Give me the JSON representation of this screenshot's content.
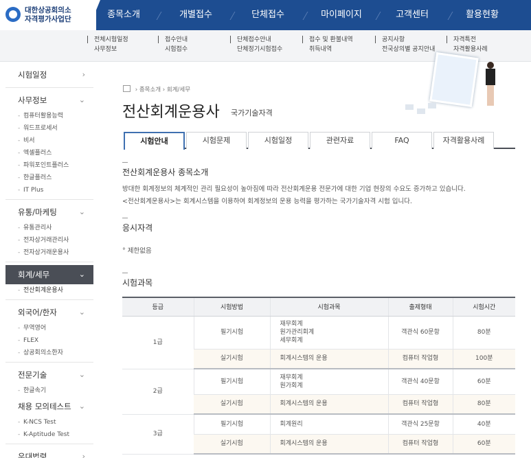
{
  "logo": {
    "line1": "대한상공회의소",
    "line2": "자격평가사업단"
  },
  "nav": [
    "종목소개",
    "개별접수",
    "단체접수",
    "마이페이지",
    "고객센터",
    "활용현황"
  ],
  "submenu": [
    [
      "전체시험일정",
      "사무정보"
    ],
    [
      "접수안내",
      "시험접수"
    ],
    [
      "단체접수안내",
      "단체정기시험접수"
    ],
    [
      "접수 및 환불내역",
      "취득내역"
    ],
    [
      "공지사항",
      "전국상의별 공지안내"
    ],
    [
      "자격특전",
      "자격활용사례"
    ]
  ],
  "sidebar": {
    "sched": "시험일정",
    "office": {
      "label": "사무정보",
      "items": [
        "컴퓨터활용능력",
        "워드프로세서",
        "비서",
        "엑셀플러스",
        "파워포인트플러스",
        "한글플러스",
        "IT Plus"
      ]
    },
    "marketing": {
      "label": "유통/마케팅",
      "items": [
        "유통관리사",
        "전자상거래관리사",
        "전자상거래운용사"
      ]
    },
    "accounting": {
      "label": "회계/세무",
      "items": [
        "전산회계운용사"
      ]
    },
    "language": {
      "label": "외국어/한자",
      "items": [
        "무역영어",
        "FLEX",
        "상공회의소한자"
      ]
    },
    "tech": {
      "label": "전문기술",
      "items": [
        "한글속기"
      ]
    },
    "mock": {
      "label": "채용 모의테스트",
      "items": [
        "K-NCS Test",
        "K-Aptitude Test"
      ]
    },
    "pref": "우대법령"
  },
  "breadcrumb": {
    "a": "종목소개",
    "b": "회계/세무"
  },
  "page": {
    "title": "전산회계운용사",
    "subtitle": "국가기술자격"
  },
  "tabs": [
    "시험안내",
    "시험문제",
    "시험일정",
    "관련자료",
    "FAQ",
    "자격활용사례"
  ],
  "intro": {
    "title": "전산회계운용사 종목소개",
    "line1": "방대한 회계정보의 체계적인 관리 필요성이 높아짐에 따라 전산회계운용 전문가에 대한 기업 현장의 수요도 증가하고 있습니다.",
    "line2": "<전산회계운용사>는 회계시스템을 이용하여 회계정보의 운용 능력을 평가하는 국가기술자격 시험 입니다."
  },
  "qualification": {
    "title": "응시자격",
    "item": "제한없음"
  },
  "subjects": {
    "title": "시험과목",
    "headers": [
      "등급",
      "시험방법",
      "시험과목",
      "출제형태",
      "시험시간"
    ],
    "rows": {
      "g1": {
        "grade": "1급",
        "w": {
          "method": "필기시험",
          "s1": "재무회계",
          "s2": "원가관리회계",
          "s3": "세무회계",
          "form": "객관식 60문항",
          "time": "80분"
        },
        "p": {
          "method": "실기시험",
          "subject": "회계시스템의 운용",
          "form": "컴퓨터 작업형",
          "time": "100분"
        }
      },
      "g2": {
        "grade": "2급",
        "w": {
          "method": "필기시험",
          "s1": "재무회계",
          "s2": "원가회계",
          "form": "객관식 40문항",
          "time": "60분"
        },
        "p": {
          "method": "실기시험",
          "subject": "회계시스템의 운용",
          "form": "컴퓨터 작업형",
          "time": "80분"
        }
      },
      "g3": {
        "grade": "3급",
        "w": {
          "method": "필기시험",
          "s1": "회계원리",
          "form": "객관식 25문항",
          "time": "40분"
        },
        "p": {
          "method": "실기시험",
          "subject": "회계시스템의 운용",
          "form": "컴퓨터 작업형",
          "time": "60분"
        }
      }
    }
  }
}
